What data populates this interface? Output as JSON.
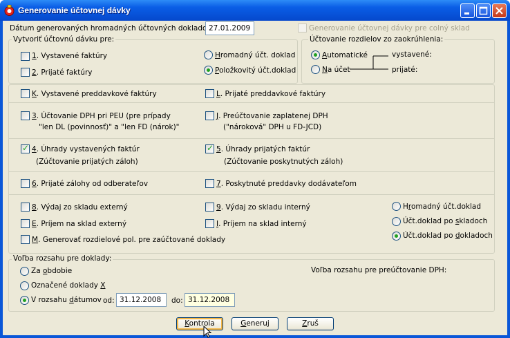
{
  "window": {
    "title": "Generovanie účtovnej dávky",
    "controls": [
      "minimize",
      "maximize",
      "close"
    ]
  },
  "date_row": {
    "label": "Dátum generovaných hromadných účtovných dokladov:",
    "value": "27.01.2009",
    "colny_sklad_label": "Generovanie účtovnej dávky pre colný sklad",
    "colny_sklad_checked": false
  },
  "vytvorit": {
    "legend": "Vytvoriť účtovnú dávku pre:",
    "vystavene": {
      "key": "1",
      "text": ". Vystavené faktúry",
      "checked": false
    },
    "prijate": {
      "key": "2",
      "text": ". Prijaté faktúry",
      "checked": false
    },
    "hromadny": {
      "key": "H",
      "text": "romadný účt. doklad",
      "selected": false
    },
    "polozkovity": {
      "key": "P",
      "text": "oložkovitý účt.doklad",
      "selected": true
    }
  },
  "zaokruhlenie": {
    "legend": "Účtovanie rozdielov zo zaokrúhlenia:",
    "automaticke": {
      "key": "A",
      "text": "utomatické",
      "selected": true
    },
    "na_ucet": {
      "key": "N",
      "text": "a účet",
      "selected": false
    },
    "vystavene_label": "vystavené:",
    "prijate_label": "prijaté:"
  },
  "preddavky": {
    "k": {
      "key": "K",
      "text": ". Vystavené preddavkové faktúry",
      "checked": false
    },
    "l": {
      "key": "L",
      "text": ". Prijaté preddavkové faktúry",
      "checked": false
    }
  },
  "dph": {
    "u3": {
      "key": "3",
      "line1": ". Účtovanie DPH pri PEU  (pre prípady",
      "line2": "\"len DL (povinnosť)\" a \"len FD (nárok)\"",
      "checked": false
    },
    "j": {
      "key": "J",
      "line1": ". Preúčtovanie zaplatenej DPH",
      "line2": "(\"nároková\" DPH u FD-JCD)",
      "checked": false
    }
  },
  "uhrady": {
    "u4": {
      "key": "4",
      "line1": ". Úhrady vystavených faktúr",
      "line2": "(Zúčtovanie prijatých záloh)",
      "checked": true
    },
    "u5": {
      "key": "5",
      "line1": ". Úhrady prijatých faktúr",
      "line2": "(Zúčtovanie poskytnutých záloh)",
      "checked": true
    }
  },
  "zalohy": {
    "u6": {
      "key": "6",
      "text": ". Prijaté zálohy od odberateľov",
      "checked": false
    },
    "u7": {
      "key": "7",
      "text": ". Poskytnuté preddavky dodávateľom",
      "checked": false
    }
  },
  "sklad": {
    "u8": {
      "key": "8",
      "text": ". Výdaj zo skladu externý",
      "checked": false
    },
    "u9": {
      "key": "9",
      "text": ". Výdaj zo skladu interný",
      "checked": false
    },
    "e": {
      "key": "E",
      "text": ". Príjem na sklad externý",
      "checked": false
    },
    "i": {
      "key": "I",
      "text": ". Príjem na sklad interný",
      "checked": false
    },
    "m": {
      "key": "M",
      "text": ". Generovať rozdielové pol. pre zaúčtované doklady",
      "checked": false
    },
    "hromadny": {
      "key": "r",
      "pre": "H",
      "post": "omadný účt.doklad",
      "selected": false
    },
    "po_skladoch": {
      "pre": "Účt.doklad po ",
      "key": "s",
      "post": "kladoch",
      "selected": false
    },
    "po_dokladoch": {
      "pre": "Účt.doklad po ",
      "key": "d",
      "post": "okladoch",
      "selected": true
    }
  },
  "rozsah": {
    "legend": "Voľba rozsahu pre doklady:",
    "za_obdobie": {
      "pre": "Za ",
      "key": "o",
      "post": "bdobie",
      "selected": false
    },
    "oznacene": {
      "pre": "Označené doklady ",
      "key": "X",
      "post": "",
      "selected": false
    },
    "v_rozsahu": {
      "pre": "V rozsahu ",
      "key": "d",
      "post": "átumov",
      "selected": true
    },
    "od_label": "od:",
    "od_value": "31.12.2008",
    "do_label": "do:",
    "do_value": "31.12.2008",
    "dph_label": "Voľba rozsahu pre preúčtovanie DPH:"
  },
  "buttons": {
    "kontrola": {
      "key": "K",
      "post": "ontrola"
    },
    "generuj": {
      "key": "G",
      "post": "eneruj"
    },
    "zrus": {
      "key": "Z",
      "post": "ruš"
    }
  }
}
